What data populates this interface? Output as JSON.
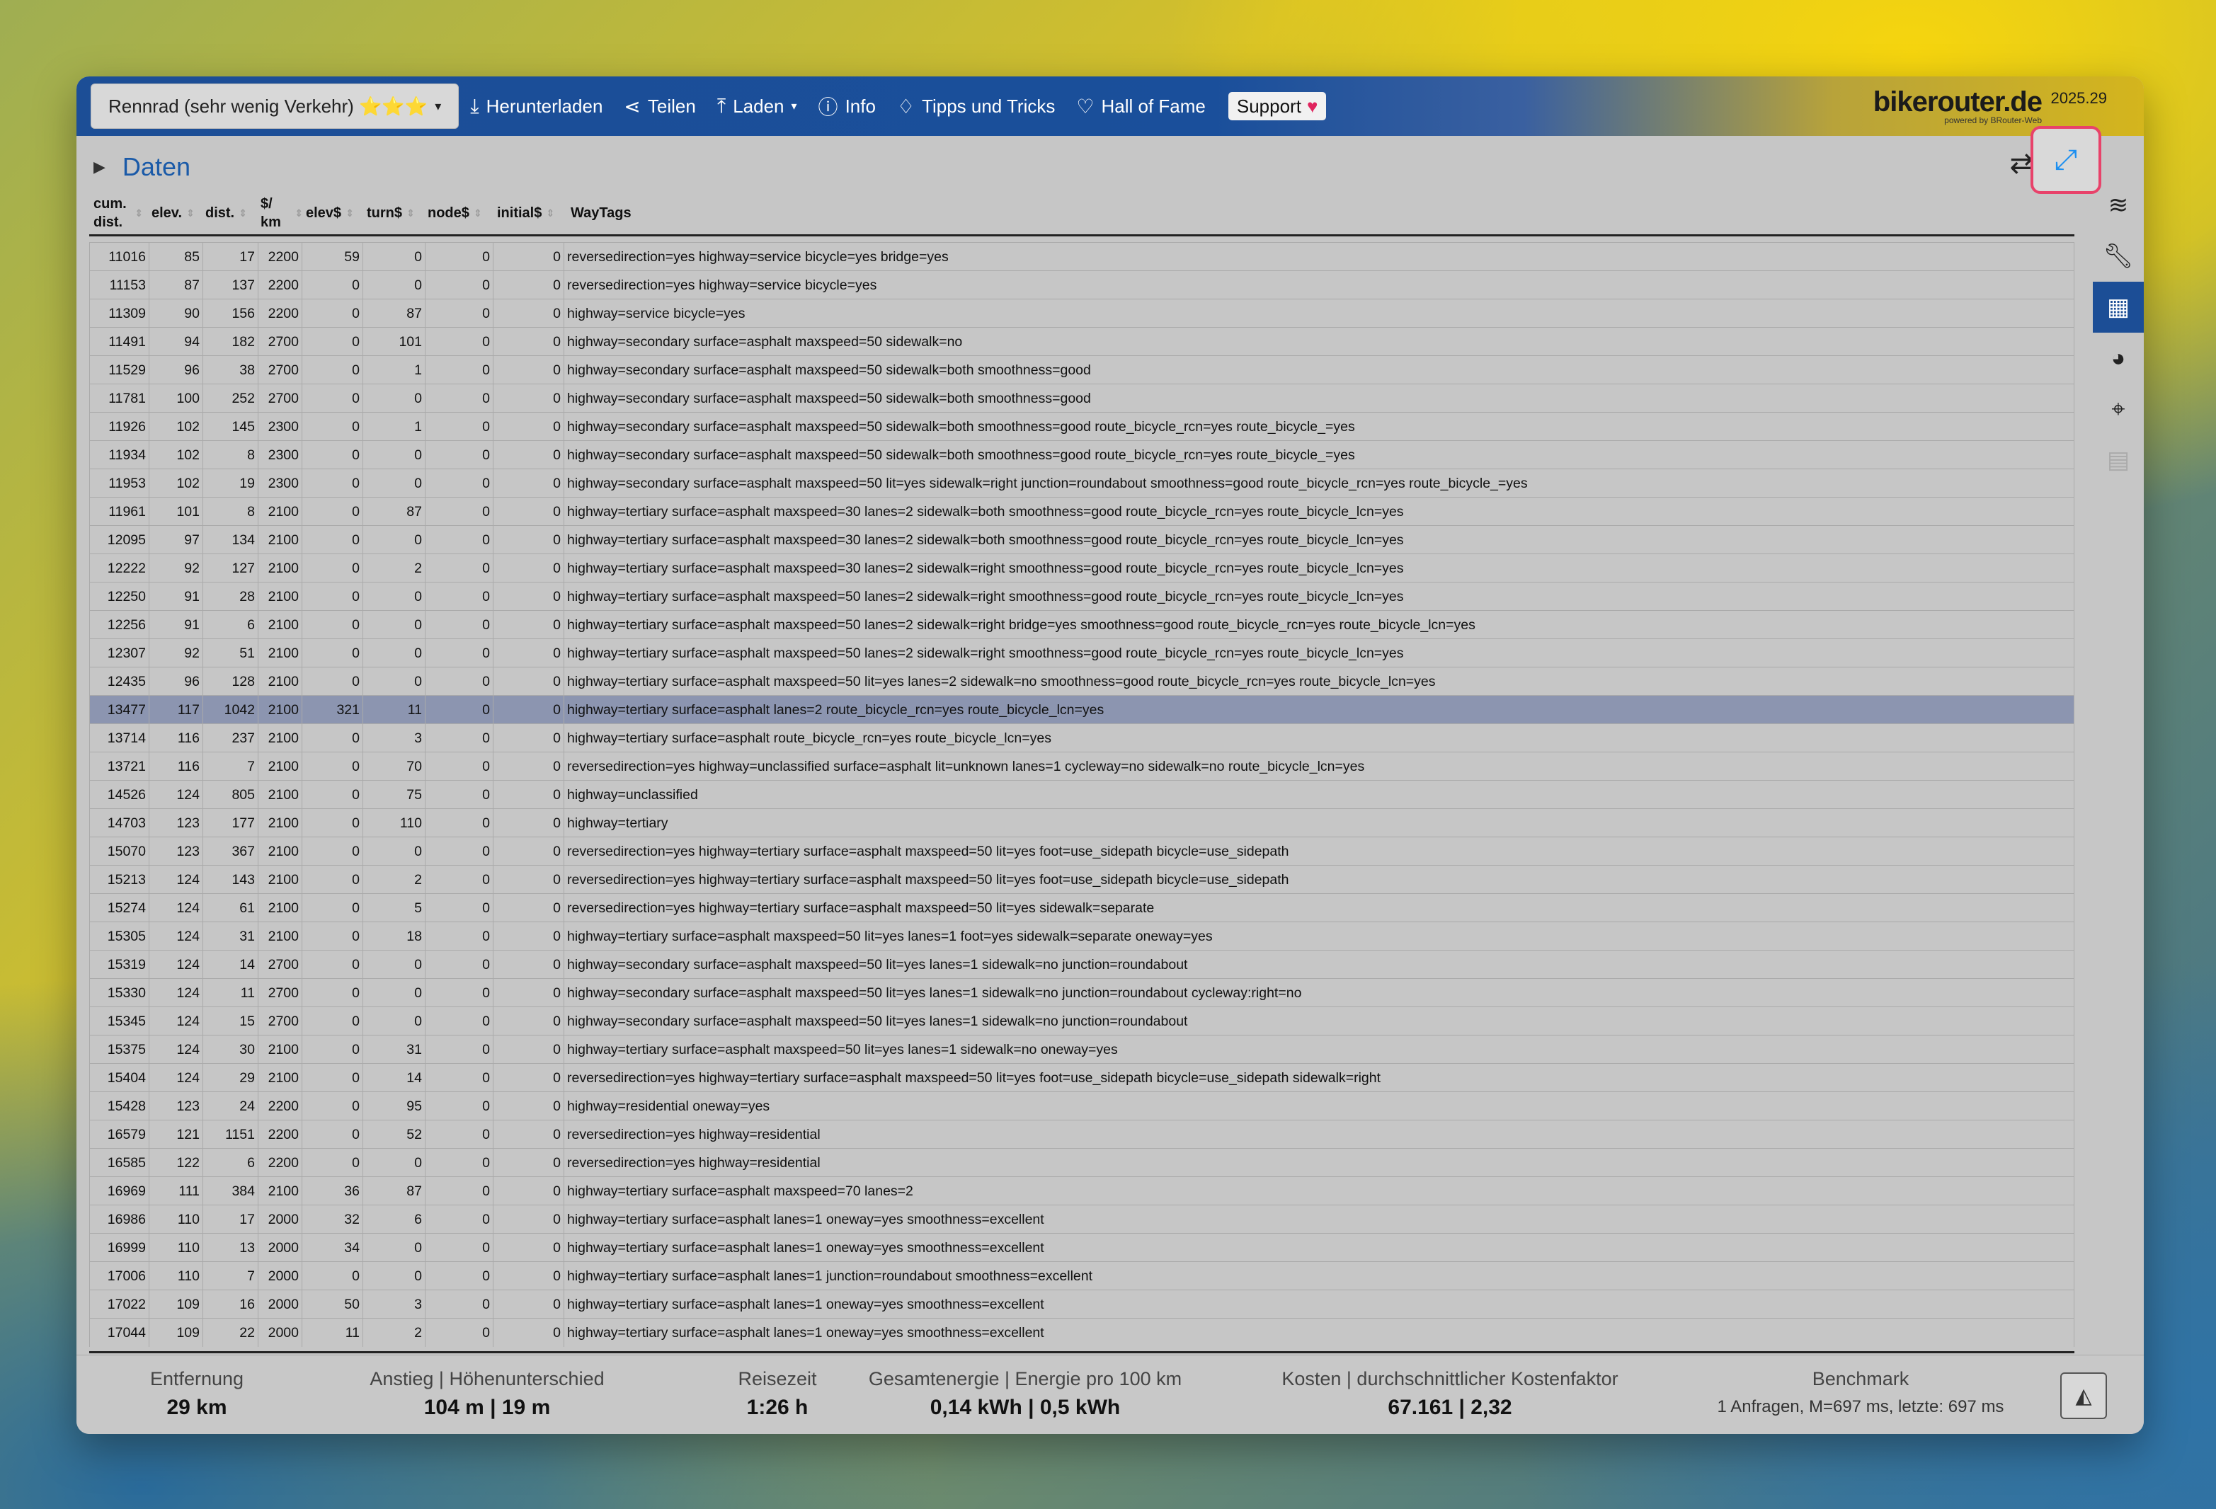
{
  "navbar": {
    "profile": "Rennrad (sehr wenig Verkehr) ⭐⭐⭐",
    "items": [
      {
        "label": "Herunterladen",
        "icon": "download-icon"
      },
      {
        "label": "Teilen",
        "icon": "share-icon"
      },
      {
        "label": "Laden",
        "icon": "upload-icon"
      },
      {
        "label": "Info",
        "icon": "info-icon"
      },
      {
        "label": "Tipps und Tricks",
        "icon": "lightbulb-icon"
      },
      {
        "label": "Hall of Fame",
        "icon": "heart-outline-icon"
      }
    ],
    "support": "Support",
    "brand": "bikerouter.de",
    "brand_sub": "powered by BRouter-Web",
    "version": "2025.29"
  },
  "panel": {
    "title": "Daten"
  },
  "table": {
    "columns": [
      {
        "key": "cum",
        "label": "cum. dist."
      },
      {
        "key": "elev",
        "label": "elev."
      },
      {
        "key": "dist",
        "label": "dist."
      },
      {
        "key": "costpkm",
        "label": "$/ km"
      },
      {
        "key": "elevc",
        "label": "elev$"
      },
      {
        "key": "turn",
        "label": "turn$"
      },
      {
        "key": "node",
        "label": "node$"
      },
      {
        "key": "init",
        "label": "initial$"
      },
      {
        "key": "tags",
        "label": "WayTags"
      }
    ],
    "rows": [
      [
        "11016",
        "85",
        "17",
        "2200",
        "59",
        "0",
        "0",
        "0",
        "reversedirection=yes highway=service bicycle=yes bridge=yes"
      ],
      [
        "11153",
        "87",
        "137",
        "2200",
        "0",
        "0",
        "0",
        "0",
        "reversedirection=yes highway=service bicycle=yes"
      ],
      [
        "11309",
        "90",
        "156",
        "2200",
        "0",
        "87",
        "0",
        "0",
        "highway=service bicycle=yes"
      ],
      [
        "11491",
        "94",
        "182",
        "2700",
        "0",
        "101",
        "0",
        "0",
        "highway=secondary surface=asphalt maxspeed=50 sidewalk=no"
      ],
      [
        "11529",
        "96",
        "38",
        "2700",
        "0",
        "1",
        "0",
        "0",
        "highway=secondary surface=asphalt maxspeed=50 sidewalk=both smoothness=good"
      ],
      [
        "11781",
        "100",
        "252",
        "2700",
        "0",
        "0",
        "0",
        "0",
        "highway=secondary surface=asphalt maxspeed=50 sidewalk=both smoothness=good"
      ],
      [
        "11926",
        "102",
        "145",
        "2300",
        "0",
        "1",
        "0",
        "0",
        "highway=secondary surface=asphalt maxspeed=50 sidewalk=both smoothness=good route_bicycle_rcn=yes route_bicycle_=yes"
      ],
      [
        "11934",
        "102",
        "8",
        "2300",
        "0",
        "0",
        "0",
        "0",
        "highway=secondary surface=asphalt maxspeed=50 sidewalk=both smoothness=good route_bicycle_rcn=yes route_bicycle_=yes"
      ],
      [
        "11953",
        "102",
        "19",
        "2300",
        "0",
        "0",
        "0",
        "0",
        "highway=secondary surface=asphalt maxspeed=50 lit=yes sidewalk=right junction=roundabout smoothness=good route_bicycle_rcn=yes route_bicycle_=yes"
      ],
      [
        "11961",
        "101",
        "8",
        "2100",
        "0",
        "87",
        "0",
        "0",
        "highway=tertiary surface=asphalt maxspeed=30 lanes=2 sidewalk=both smoothness=good route_bicycle_rcn=yes route_bicycle_lcn=yes"
      ],
      [
        "12095",
        "97",
        "134",
        "2100",
        "0",
        "0",
        "0",
        "0",
        "highway=tertiary surface=asphalt maxspeed=30 lanes=2 sidewalk=both smoothness=good route_bicycle_rcn=yes route_bicycle_lcn=yes"
      ],
      [
        "12222",
        "92",
        "127",
        "2100",
        "0",
        "2",
        "0",
        "0",
        "highway=tertiary surface=asphalt maxspeed=30 lanes=2 sidewalk=right smoothness=good route_bicycle_rcn=yes route_bicycle_lcn=yes"
      ],
      [
        "12250",
        "91",
        "28",
        "2100",
        "0",
        "0",
        "0",
        "0",
        "highway=tertiary surface=asphalt maxspeed=50 lanes=2 sidewalk=right smoothness=good route_bicycle_rcn=yes route_bicycle_lcn=yes"
      ],
      [
        "12256",
        "91",
        "6",
        "2100",
        "0",
        "0",
        "0",
        "0",
        "highway=tertiary surface=asphalt maxspeed=50 lanes=2 sidewalk=right bridge=yes smoothness=good route_bicycle_rcn=yes route_bicycle_lcn=yes"
      ],
      [
        "12307",
        "92",
        "51",
        "2100",
        "0",
        "0",
        "0",
        "0",
        "highway=tertiary surface=asphalt maxspeed=50 lanes=2 sidewalk=right smoothness=good route_bicycle_rcn=yes route_bicycle_lcn=yes"
      ],
      [
        "12435",
        "96",
        "128",
        "2100",
        "0",
        "0",
        "0",
        "0",
        "highway=tertiary surface=asphalt maxspeed=50 lit=yes lanes=2 sidewalk=no smoothness=good route_bicycle_rcn=yes route_bicycle_lcn=yes"
      ],
      [
        "13477",
        "117",
        "1042",
        "2100",
        "321",
        "11",
        "0",
        "0",
        "highway=tertiary surface=asphalt lanes=2 route_bicycle_rcn=yes route_bicycle_lcn=yes"
      ],
      [
        "13714",
        "116",
        "237",
        "2100",
        "0",
        "3",
        "0",
        "0",
        "highway=tertiary surface=asphalt route_bicycle_rcn=yes route_bicycle_lcn=yes"
      ],
      [
        "13721",
        "116",
        "7",
        "2100",
        "0",
        "70",
        "0",
        "0",
        "reversedirection=yes highway=unclassified surface=asphalt lit=unknown lanes=1 cycleway=no sidewalk=no route_bicycle_lcn=yes"
      ],
      [
        "14526",
        "124",
        "805",
        "2100",
        "0",
        "75",
        "0",
        "0",
        "highway=unclassified"
      ],
      [
        "14703",
        "123",
        "177",
        "2100",
        "0",
        "110",
        "0",
        "0",
        "highway=tertiary"
      ],
      [
        "15070",
        "123",
        "367",
        "2100",
        "0",
        "0",
        "0",
        "0",
        "reversedirection=yes highway=tertiary surface=asphalt maxspeed=50 lit=yes foot=use_sidepath bicycle=use_sidepath"
      ],
      [
        "15213",
        "124",
        "143",
        "2100",
        "0",
        "2",
        "0",
        "0",
        "reversedirection=yes highway=tertiary surface=asphalt maxspeed=50 lit=yes foot=use_sidepath bicycle=use_sidepath"
      ],
      [
        "15274",
        "124",
        "61",
        "2100",
        "0",
        "5",
        "0",
        "0",
        "reversedirection=yes highway=tertiary surface=asphalt maxspeed=50 lit=yes sidewalk=separate"
      ],
      [
        "15305",
        "124",
        "31",
        "2100",
        "0",
        "18",
        "0",
        "0",
        "highway=tertiary surface=asphalt maxspeed=50 lit=yes lanes=1 foot=yes sidewalk=separate oneway=yes"
      ],
      [
        "15319",
        "124",
        "14",
        "2700",
        "0",
        "0",
        "0",
        "0",
        "highway=secondary surface=asphalt maxspeed=50 lit=yes lanes=1 sidewalk=no junction=roundabout"
      ],
      [
        "15330",
        "124",
        "11",
        "2700",
        "0",
        "0",
        "0",
        "0",
        "highway=secondary surface=asphalt maxspeed=50 lit=yes lanes=1 sidewalk=no junction=roundabout cycleway:right=no"
      ],
      [
        "15345",
        "124",
        "15",
        "2700",
        "0",
        "0",
        "0",
        "0",
        "highway=secondary surface=asphalt maxspeed=50 lit=yes lanes=1 sidewalk=no junction=roundabout"
      ],
      [
        "15375",
        "124",
        "30",
        "2100",
        "0",
        "31",
        "0",
        "0",
        "highway=tertiary surface=asphalt maxspeed=50 lit=yes lanes=1 sidewalk=no oneway=yes"
      ],
      [
        "15404",
        "124",
        "29",
        "2100",
        "0",
        "14",
        "0",
        "0",
        "reversedirection=yes highway=tertiary surface=asphalt maxspeed=50 lit=yes foot=use_sidepath bicycle=use_sidepath sidewalk=right"
      ],
      [
        "15428",
        "123",
        "24",
        "2200",
        "0",
        "95",
        "0",
        "0",
        "highway=residential oneway=yes"
      ],
      [
        "16579",
        "121",
        "1151",
        "2200",
        "0",
        "52",
        "0",
        "0",
        "reversedirection=yes highway=residential"
      ],
      [
        "16585",
        "122",
        "6",
        "2200",
        "0",
        "0",
        "0",
        "0",
        "reversedirection=yes highway=residential"
      ],
      [
        "16969",
        "111",
        "384",
        "2100",
        "36",
        "87",
        "0",
        "0",
        "highway=tertiary surface=asphalt maxspeed=70 lanes=2"
      ],
      [
        "16986",
        "110",
        "17",
        "2000",
        "32",
        "6",
        "0",
        "0",
        "highway=tertiary surface=asphalt lanes=1 oneway=yes smoothness=excellent"
      ],
      [
        "16999",
        "110",
        "13",
        "2000",
        "34",
        "0",
        "0",
        "0",
        "highway=tertiary surface=asphalt lanes=1 oneway=yes smoothness=excellent"
      ],
      [
        "17006",
        "110",
        "7",
        "2000",
        "0",
        "0",
        "0",
        "0",
        "highway=tertiary surface=asphalt lanes=1 junction=roundabout smoothness=excellent"
      ],
      [
        "17022",
        "109",
        "16",
        "2000",
        "50",
        "3",
        "0",
        "0",
        "highway=tertiary surface=asphalt lanes=1 oneway=yes smoothness=excellent"
      ],
      [
        "17044",
        "109",
        "22",
        "2000",
        "11",
        "2",
        "0",
        "0",
        "highway=tertiary surface=asphalt lanes=1 oneway=yes smoothness=excellent"
      ]
    ],
    "selected_row": 16
  },
  "footer": {
    "stats": [
      {
        "label": "Entfernung",
        "value": "29 km"
      },
      {
        "label": "Anstieg | Höhenunterschied",
        "value": "104 m | 19 m"
      },
      {
        "label": "Reisezeit",
        "value": "1:26 h"
      },
      {
        "label": "Gesamtenergie | Energie pro 100 km",
        "value": "0,14 kWh | 0,5 kWh"
      },
      {
        "label": "Kosten | durchschnittlicher Kostenfaktor",
        "value": "67.161 | 2,32"
      },
      {
        "label": "Benchmark",
        "value": "1 Anfragen, M=697 ms, letzte: 697 ms"
      }
    ]
  },
  "colors": {
    "accent": "#1c4e96",
    "highlight": "#e8426a",
    "selected_row": "#8c95b0"
  }
}
